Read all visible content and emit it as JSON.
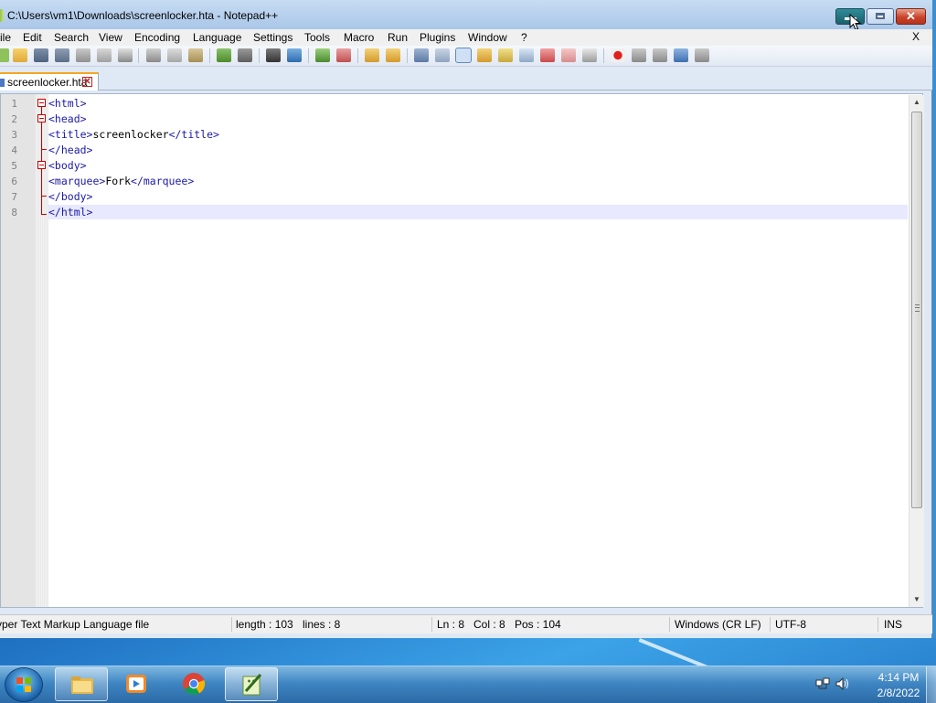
{
  "window": {
    "title": "C:\\Users\\vm1\\Downloads\\screenlocker.hta - Notepad++",
    "close_glyph": "✕"
  },
  "menu": {
    "items": [
      "ile",
      "Edit",
      "Search",
      "View",
      "Encoding",
      "Language",
      "Settings",
      "Tools",
      "Macro",
      "Run",
      "Plugins",
      "Window",
      "?"
    ],
    "close_doc": "X"
  },
  "tab": {
    "label": "screenlocker.hta",
    "close_glyph": "✕"
  },
  "editor": {
    "line_numbers": [
      "1",
      "2",
      "3",
      "4",
      "5",
      "6",
      "7",
      "8"
    ],
    "lines": [
      {
        "tag_open": "<html>",
        "text": "",
        "tag_close": ""
      },
      {
        "tag_open": "<head>",
        "text": "",
        "tag_close": ""
      },
      {
        "tag_open": "<title>",
        "text": "screenlocker",
        "tag_close": "</title>"
      },
      {
        "tag_open": "</head>",
        "text": "",
        "tag_close": ""
      },
      {
        "tag_open": "<body>",
        "text": "",
        "tag_close": ""
      },
      {
        "tag_open": "<marquee>",
        "text": "Fork",
        "tag_close": "</marquee>"
      },
      {
        "tag_open": "</body>",
        "text": "",
        "tag_close": ""
      },
      {
        "tag_open": "</html>",
        "text": "",
        "tag_close": ""
      }
    ],
    "current_line": 8
  },
  "statusbar": {
    "file_type": "yper Text Markup Language file",
    "length": "length : 103",
    "lines": "lines : 8",
    "ln": "Ln : 8",
    "col": "Col : 8",
    "pos": "Pos : 104",
    "eol": "Windows (CR LF)",
    "encoding": "UTF-8",
    "mode": "INS"
  },
  "taskbar": {
    "apps": [
      "file-explorer-icon",
      "media-player-icon",
      "chrome-icon",
      "notepad-plus-plus-icon"
    ],
    "time": "4:14 PM",
    "date": "2/8/2022"
  },
  "colors": {
    "tag": "#1a1aa6",
    "tab_accent": "#f5a623",
    "close_button": "#c9432b",
    "minimize_button": "#1d5f6a"
  }
}
